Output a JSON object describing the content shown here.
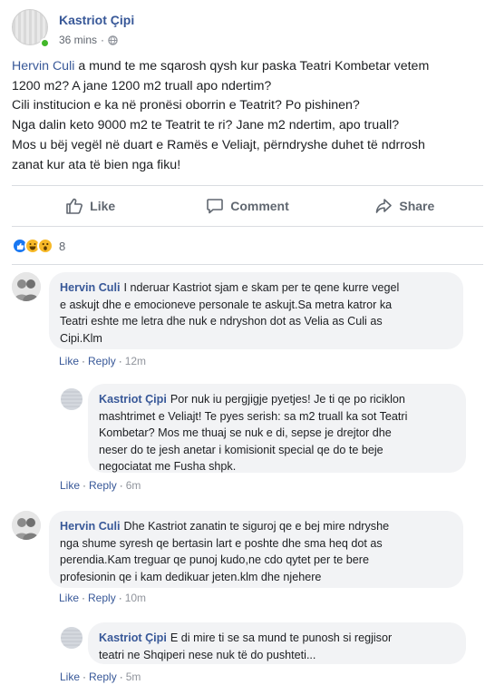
{
  "post": {
    "author": "Kastriot Çipi",
    "time": "36 mins",
    "separator": "·",
    "mention": "Hervin Culi",
    "lines": [
      " a mund te me sqarosh qysh kur paska Teatri Kombetar vetem",
      "1200 m2? A jane 1200 m2 truall apo ndertim?",
      "Cili institucion e ka në pronësi oborrin e Teatrit? Po pishinen?",
      "Nga dalin keto 9000 m2 te Teatrit te ri? Jane m2 ndertim, apo truall?",
      "Mos u bëj vegël në duart e Ramës e Veliajt, përndryshe duhet të ndrrosh",
      "zanat kur ata të bien nga fiku!"
    ]
  },
  "actions": {
    "like": "Like",
    "comment": "Comment",
    "share": "Share"
  },
  "reactions": {
    "icons": [
      "like-icon",
      "haha-icon",
      "wow-icon"
    ],
    "count": "8"
  },
  "comments": [
    {
      "author": "Hervin Culi",
      "lines": [
        "I nderuar Kastriot sjam e skam per te qene kurre vegel",
        "e askujt dhe e emocioneve personale te askujt.Sa metra katror ka",
        "Teatri eshte me letra dhe nuk e ndryshon dot as Velia as Culi as",
        "Cipi.Klm"
      ],
      "like": "Like",
      "reply": "Reply",
      "time": "12m"
    },
    {
      "author": "Kastriot Çipi",
      "lines": [
        "Por nuk iu pergjigje pyetjes! Je ti qe po riciklon",
        "mashtrimet e Veliajt! Te pyes serish: sa m2 truall ka sot Teatri",
        "Kombetar? Mos me thuaj se nuk e di, sepse je drejtor dhe",
        "neser do te jesh anetar i komisionit special qe do te beje",
        "negociatat me Fusha shpk."
      ],
      "like": "Like",
      "reply": "Reply",
      "time": "6m"
    },
    {
      "author": "Hervin Culi",
      "lines": [
        "Dhe Kastriot zanatin te siguroj qe e bej mire ndryshe",
        "nga shume syresh qe bertasin lart e poshte dhe sma heq dot as",
        "perendia.Kam treguar qe punoj kudo,ne cdo qytet per te bere",
        "profesionin qe i kam dedikuar jeten.klm dhe njehere"
      ],
      "like": "Like",
      "reply": "Reply",
      "time": "10m"
    },
    {
      "author": "Kastriot Çipi",
      "lines": [
        "E di mire ti se sa mund te punosh si regjisor",
        "teatri ne Shqiperi nese nuk të do pushteti..."
      ],
      "like": "Like",
      "reply": "Reply",
      "time": "5m"
    }
  ],
  "colors": {
    "link": "#385898",
    "bubble": "#f2f3f5",
    "online": "#42b72a",
    "like_reaction": "#1877f2"
  }
}
